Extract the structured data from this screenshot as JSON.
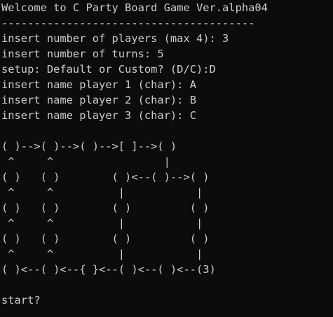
{
  "colors": {
    "background": "#0c0c0c",
    "foreground": "#cccccc"
  },
  "console": {
    "lines": [
      "Welcome to C Party Board Game Ver.alpha04",
      "---------------------------------------",
      "insert number of players (max 4): 3",
      "insert number of turns: 5",
      "setup: Default or Custom? (D/C):D",
      "insert name player 1 (char): A",
      "insert name player 2 (char): B",
      "insert name player 3 (char): C",
      "",
      "( )-->( )-->( )-->[ ]-->( )",
      " ^     ^                 |",
      "( )   ( )        ( )<--( )-->( )",
      " ^     ^          |           |",
      "( )   ( )        ( )         ( )",
      " ^     ^          |           |",
      "( )   ( )        ( )         ( )",
      " ^     ^          |           |",
      "( )<--( )<--{ }<--( )<--( )<--(3)",
      "",
      "start?"
    ]
  }
}
